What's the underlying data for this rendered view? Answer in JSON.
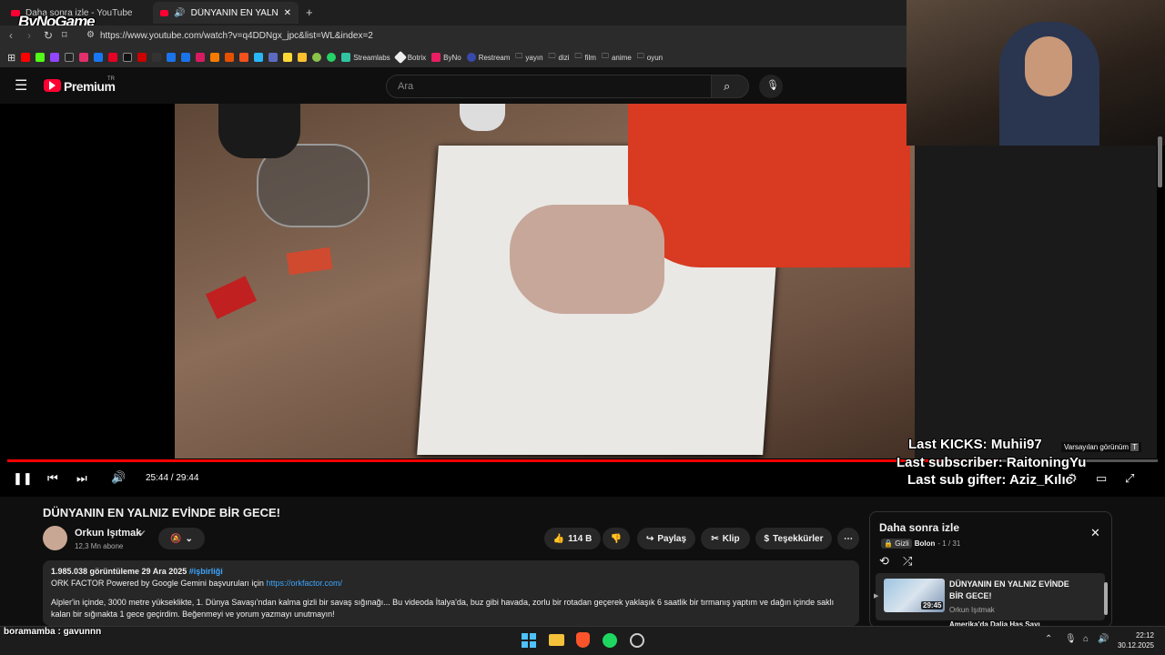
{
  "browser": {
    "tabs": [
      {
        "label": "Daha sonra izle - YouTube"
      },
      {
        "label": "DÜNYANIN EN YALNIZ EVİNDE"
      }
    ],
    "url": "https://www.youtube.com/watch?v=q4DDNgx_jpc&list=WL&index=2",
    "bookmarks": [
      "Streamlabs",
      "Botrix",
      "ByNo",
      "Restream",
      "yayın",
      "dizi",
      "film",
      "anime",
      "oyun"
    ]
  },
  "overlay": {
    "logo": "ByNoGame",
    "last_kicks": "Last KICKS: Muhii97",
    "last_subscriber": "Last subscriber: RaitoningYu",
    "last_sub_gifter": "Last sub gifter: Aziz_Kılıc",
    "chat_line": "boramamba : gavunnn"
  },
  "youtube": {
    "logo": "Premium",
    "logo_sup": "TR",
    "search_placeholder": "Ara",
    "player": {
      "time": "25:44 / 29:44",
      "progress": 0.865,
      "tooltip": "Varsayılan görünüm",
      "tooltip_key": "T"
    },
    "video": {
      "title": "DÜNYANIN EN YALNIZ EVİNDE BİR GECE!",
      "channel": "Orkun Işıtmak",
      "subscribers": "12,3 Mn abone",
      "likes": "114 B",
      "share": "Paylaş",
      "clip": "Klip",
      "thanks": "Teşekkürler",
      "stats": "1.985.038 görüntüleme  29 Ara 2025",
      "hashtag": "#işbirliği",
      "desc_line1": "ORK FACTOR Powered by Google Gemini başvuruları için ",
      "desc_link": "https://orkfactor.com/",
      "desc_line2": "Alpler'in içinde, 3000 metre yükseklikte, 1. Dünya Savaşı'ndan kalma gizli bir savaş sığınağı... Bu videoda İtalya'da, buz gibi havada, zorlu bir rotadan geçerek yaklaşık 6 saatlik bir tırmanış yaptım ve dağın içinde saklı kalan bir sığınakta 1 gece geçirdim. Beğenmeyi ve yorum yazmayı unutmayın!"
    },
    "playlist": {
      "title": "Daha sonra izle",
      "privacy": "Gizli",
      "owner": "Bolon",
      "position": "- 1 / 31",
      "item_title": "DÜNYANIN EN YALNIZ EVİNDE BİR GECE!",
      "item_channel": "Orkun Işıtmak",
      "item_duration": "29:45",
      "next_item": "Amerika'da Dalia Has Sayı"
    }
  },
  "taskbar": {
    "time": "22:12",
    "date": "30.12.2025"
  }
}
